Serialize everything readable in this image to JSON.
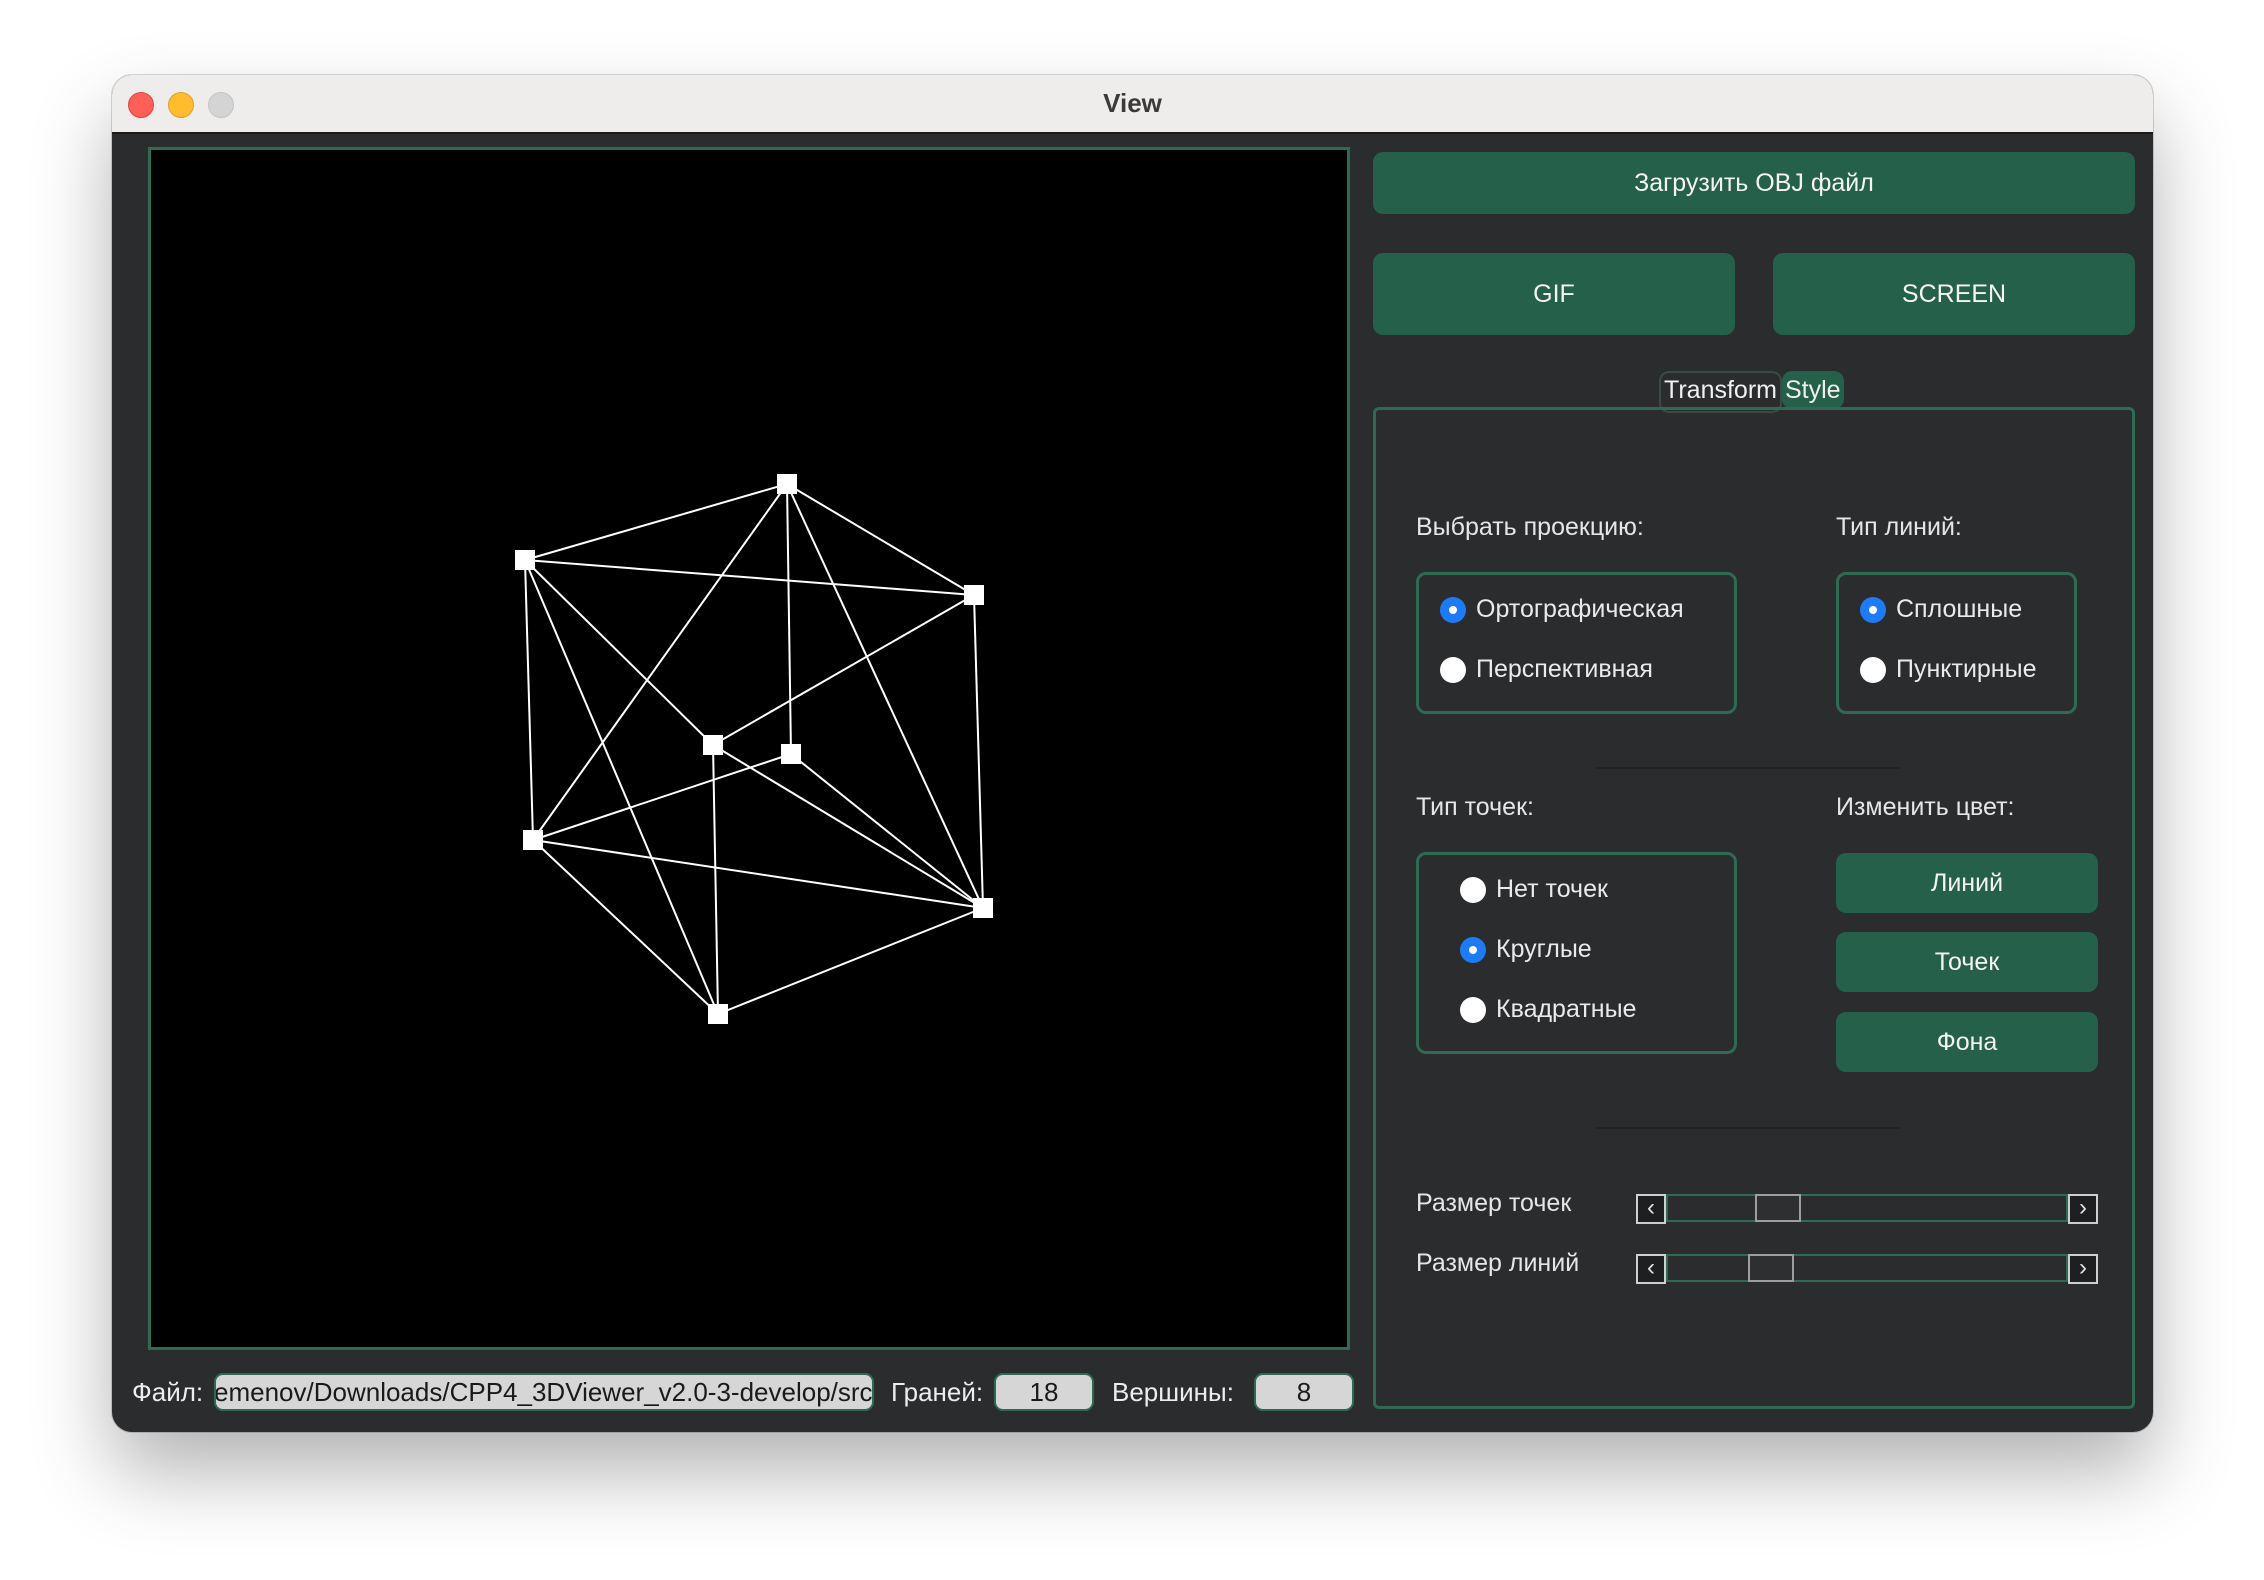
{
  "window": {
    "title": "View"
  },
  "toolbar": {
    "load_label": "Загрузить OBJ файл",
    "gif_label": "GIF",
    "screen_label": "SCREEN"
  },
  "tabs": [
    {
      "label": "Transform"
    },
    {
      "label": "Style"
    }
  ],
  "style": {
    "projection": {
      "title": "Выбрать проекцию:",
      "options": [
        "Ортографическая",
        "Перспективная"
      ],
      "selected": "Ортографическая"
    },
    "line_type": {
      "title": "Тип линий:",
      "options": [
        "Сплошные",
        "Пунктирные"
      ],
      "selected": "Сплошные"
    },
    "point_type": {
      "title": "Тип точек:",
      "options": [
        "Нет точек",
        "Круглые",
        "Квадратные"
      ],
      "selected": "Круглые"
    },
    "color": {
      "title": "Изменить цвет:",
      "lines_label": "Линий",
      "points_label": "Точек",
      "background_label": "Фона"
    },
    "point_size": {
      "label": "Размер точек",
      "value": 0.25
    },
    "line_size": {
      "label": "Размер линий",
      "value": 0.23
    }
  },
  "status": {
    "file_label": "Файл:",
    "file_value": "emenov/Downloads/CPP4_3DViewer_v2.0-3-develop/src",
    "faces_label": "Граней:",
    "faces_value": "18",
    "vertices_label": "Вершины:",
    "vertices_value": "8"
  },
  "colors": {
    "accent": "#24604a",
    "border": "#2e6b52",
    "background": "#2b2c2e",
    "radio_on": "#1d7bf5"
  }
}
